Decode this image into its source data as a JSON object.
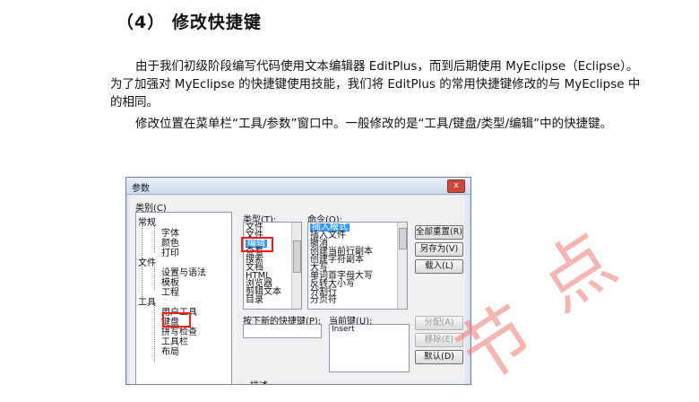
{
  "heading": "（4）  修改快捷键",
  "paragraph1": "由于我们初级阶段编写代码使用文本编辑器 EditPlus，而到后期使用 MyEclipse（Eclipse）。为了加强对 MyEclipse 的快捷键使用技能，我们将 EditPlus 的常用快捷键修改的与 MyEclipse 中的相同。",
  "paragraph2": "修改位置在菜单栏“工具/参数”窗口中。一般修改的是“工具/键盘/类型/编辑”中的快捷键。",
  "dialog": {
    "title": "参数",
    "close_label": "x",
    "category_label": "类别(C)",
    "tree": [
      "常规",
      "字体",
      "颜色",
      "打印",
      "文件",
      "设置与语法",
      "模板",
      "工程",
      "工具",
      "用户工具",
      "键盘",
      "拼写检查",
      "工具栏",
      "布局"
    ],
    "type_label": "类型(T):",
    "types": [
      "文件",
      "文件",
      "编辑",
      "查看",
      "搜索",
      "文档",
      "HTML",
      "浏览器",
      "剪辑文本",
      "目录"
    ],
    "command_label": "命令(O):",
    "commands": [
      "插入模式",
      "插入文件",
      "撤消",
      "创建当前行副本",
      "创建字符副本",
      "大写",
      "单词首字母大写",
      "反转大小写",
      "分割行",
      "分页符"
    ],
    "new_key_label": "按下新的快捷键(P):",
    "current_key_label": "当前键(U):",
    "current_key_value": "Insert",
    "buttons": {
      "reset_all": "全部重置(R)",
      "save_as": "另存为(V)",
      "load": "载入(L)",
      "assign": "分配(A)",
      "remove": "移除(E)",
      "default": "默认(D)"
    },
    "description_label": "描述"
  },
  "watermark": [
    "节",
    "点"
  ],
  "colors": {
    "highlight_box": "#ff1a1a",
    "selection": "#3399ff",
    "watermark": "#ee7878"
  }
}
